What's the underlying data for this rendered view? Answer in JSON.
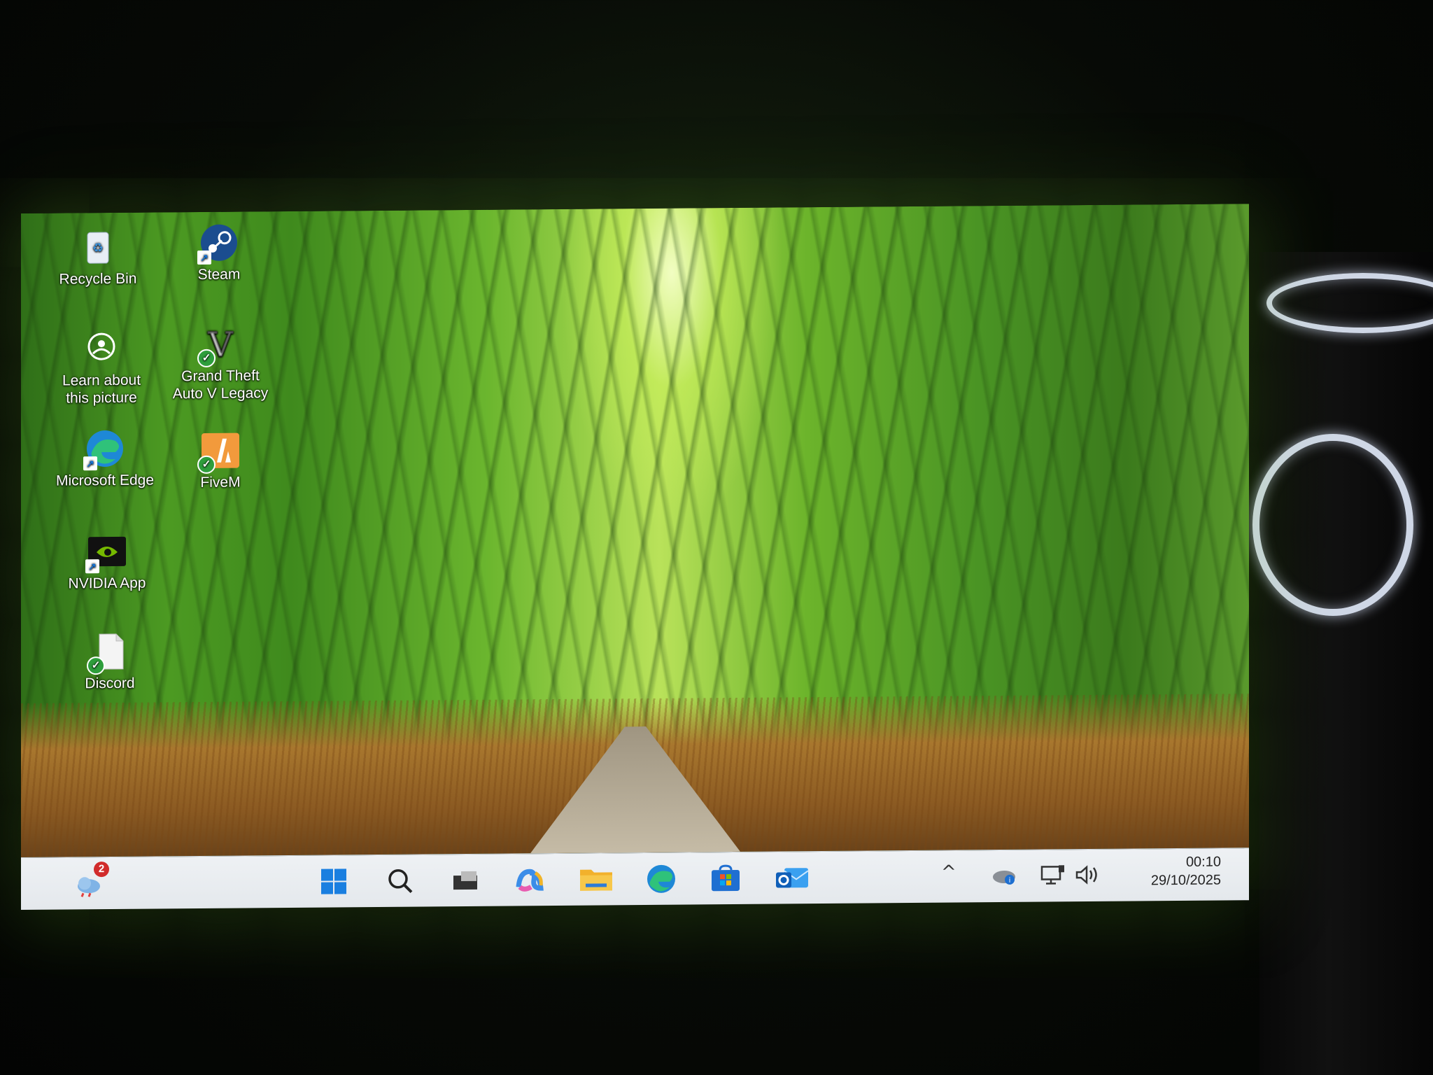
{
  "desktop": {
    "icons": [
      {
        "label": "Recycle Bin",
        "icon": "recycle-bin-icon"
      },
      {
        "label": "Steam",
        "icon": "steam-icon"
      },
      {
        "label": "Learn about this picture",
        "icon": "learn-about-picture-icon"
      },
      {
        "label": "Grand Theft Auto V Legacy",
        "icon": "gta-v-icon"
      },
      {
        "label": "Microsoft Edge",
        "icon": "edge-icon"
      },
      {
        "label": "FiveM",
        "icon": "fivem-icon"
      },
      {
        "label": "NVIDIA App",
        "icon": "nvidia-icon"
      },
      {
        "label": "Discord",
        "icon": "discord-file-icon"
      }
    ]
  },
  "taskbar": {
    "weather_badge": "2",
    "pinned": [
      "start-icon",
      "search-icon",
      "task-view-icon",
      "copilot-icon",
      "file-explorer-icon",
      "edge-icon",
      "microsoft-store-icon",
      "outlook-icon"
    ],
    "tray": {
      "chevron": "^",
      "time": "00:10",
      "date": "29/10/2025"
    }
  },
  "colors": {
    "accent_blue": "#1572d3",
    "taskbar": "#e9edf0"
  }
}
